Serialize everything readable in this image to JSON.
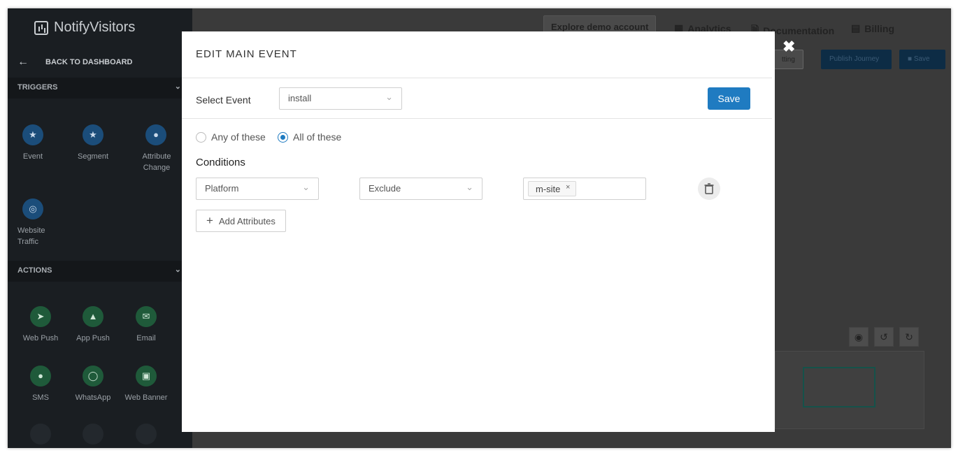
{
  "app": {
    "brand": "NotifyVisitors"
  },
  "sidebar": {
    "back_label": "BACK TO DASHBOARD",
    "triggers_label": "TRIGGERS",
    "actions_label": "ACTIONS",
    "triggers": [
      {
        "label": "Event",
        "icon": "star-icon"
      },
      {
        "label": "Segment",
        "icon": "star-icon"
      },
      {
        "label": "Attribute Change",
        "icon": "user-icon"
      },
      {
        "label": "Website Traffic",
        "icon": "globe-icon"
      }
    ],
    "actions": [
      {
        "label": "Web Push",
        "icon": "send-icon"
      },
      {
        "label": "App Push",
        "icon": "bell-icon"
      },
      {
        "label": "Email",
        "icon": "envelope-icon"
      },
      {
        "label": "SMS",
        "icon": "chat-icon"
      },
      {
        "label": "WhatsApp",
        "icon": "whatsapp-icon"
      },
      {
        "label": "Web Banner",
        "icon": "image-icon"
      }
    ]
  },
  "topbar": {
    "explore_demo": "Explore demo account",
    "analytics": "Analytics",
    "documentation": "Documentation",
    "billing": "Billing",
    "setting_partial": "tting",
    "publish_journey": "Publish Journey",
    "save": "Save"
  },
  "modal": {
    "title": "EDIT MAIN EVENT",
    "select_event_label": "Select Event",
    "select_event_value": "install",
    "save_label": "Save",
    "radio_any": "Any of these",
    "radio_all": "All of these",
    "radio_selected": "all",
    "conditions_label": "Conditions",
    "condition": {
      "attribute": "Platform",
      "operator": "Exclude",
      "values": [
        "m-site"
      ]
    },
    "add_attributes_label": "Add Attributes"
  }
}
